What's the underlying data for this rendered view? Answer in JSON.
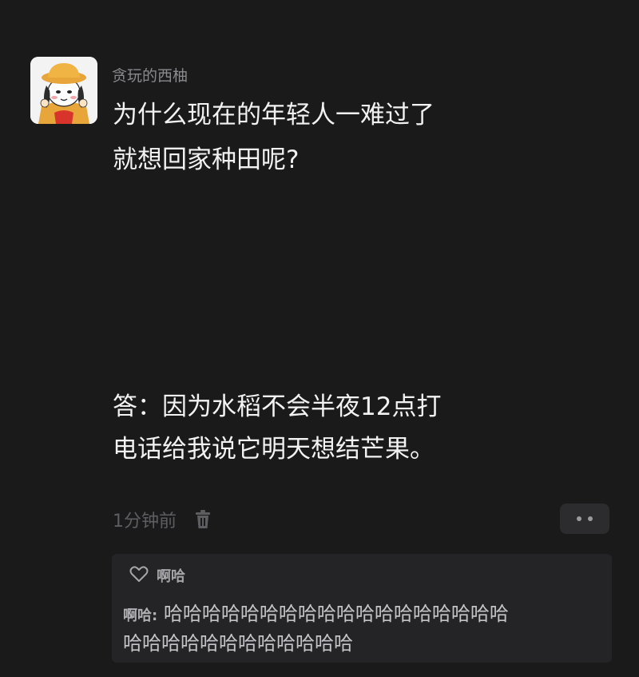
{
  "post": {
    "username": "贪玩的西柚",
    "question_lines": [
      "为什么现在的年轻人一难过了",
      "就想回家种田呢?"
    ],
    "answer_lines": [
      "答：因为水稻不会半夜12点打",
      "电话给我说它明天想结芒果。"
    ],
    "timestamp": "1分钟前"
  },
  "icons": {
    "avatar": "cartoon-avatar",
    "delete": "trash-icon",
    "more": "more-dots-icon",
    "like": "heart-icon"
  },
  "comments": {
    "like_label": "啊哈",
    "reply": {
      "author": "啊哈:",
      "lines": [
        "哈哈哈哈哈哈哈哈哈哈哈哈哈哈哈哈哈哈",
        "哈哈哈哈哈哈哈哈哈哈哈哈"
      ]
    }
  },
  "colors": {
    "background": "#1a1a1b",
    "text_primary": "#f2f2f2",
    "text_secondary": "#8a8a8e",
    "comment_bg": "#242427"
  }
}
